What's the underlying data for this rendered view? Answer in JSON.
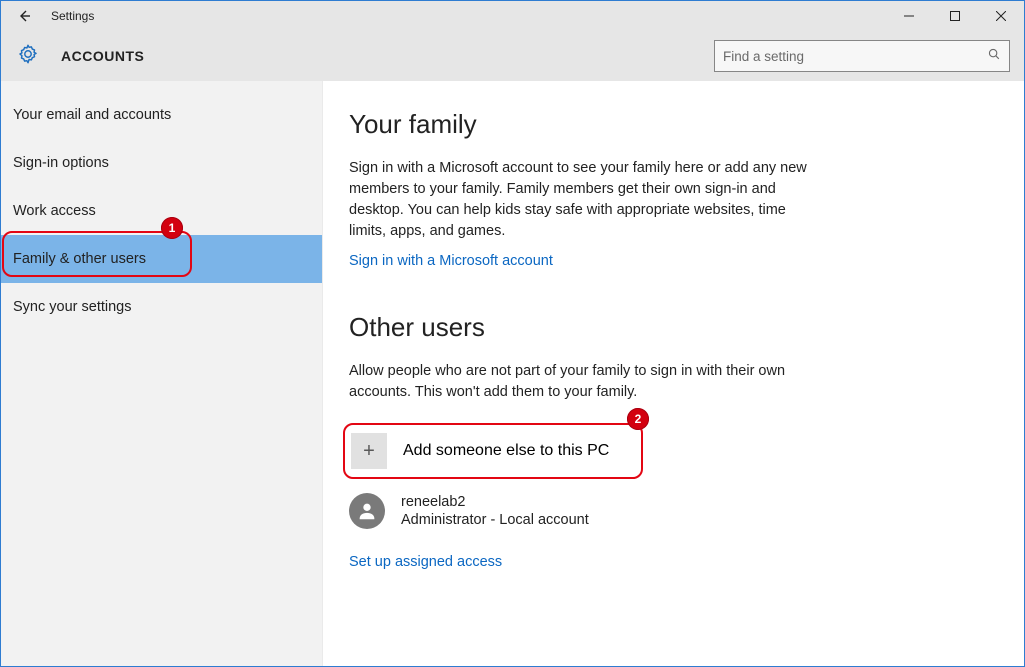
{
  "window": {
    "title": "Settings",
    "section": "ACCOUNTS"
  },
  "search": {
    "placeholder": "Find a setting",
    "value": ""
  },
  "sidebar": {
    "items": [
      {
        "label": "Your email and accounts",
        "selected": false
      },
      {
        "label": "Sign-in options",
        "selected": false
      },
      {
        "label": "Work access",
        "selected": false
      },
      {
        "label": "Family & other users",
        "selected": true
      },
      {
        "label": "Sync your settings",
        "selected": false
      }
    ]
  },
  "content": {
    "family": {
      "heading": "Your family",
      "paragraph": "Sign in with a Microsoft account to see your family here or add any new members to your family. Family members get their own sign-in and desktop. You can help kids stay safe with appropriate websites, time limits, apps, and games.",
      "link": "Sign in with a Microsoft account"
    },
    "other": {
      "heading": "Other users",
      "paragraph": "Allow people who are not part of your family to sign in with their own accounts. This won't add them to your family.",
      "add_label": "Add someone else to this PC",
      "assigned_link": "Set up assigned access"
    },
    "user": {
      "name": "reneelab2",
      "role": "Administrator - Local account"
    }
  },
  "annotations": {
    "badge1": "1",
    "badge2": "2"
  }
}
